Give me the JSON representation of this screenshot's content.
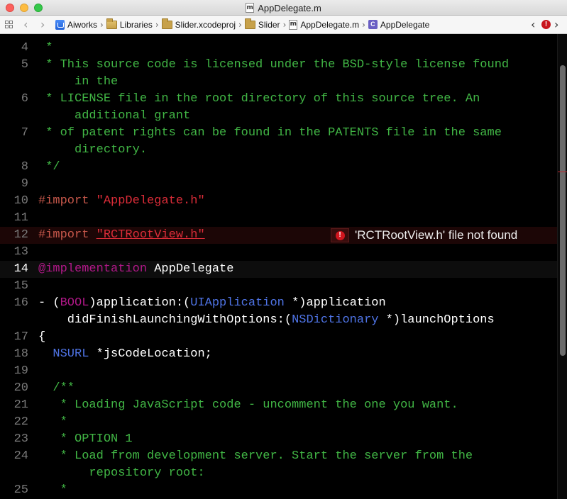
{
  "window": {
    "title": "AppDelegate.m",
    "file_icon_letter": "m"
  },
  "jumpbar": {
    "crumbs": [
      {
        "label": "Aiworks",
        "icon": "xcodeproj-icon"
      },
      {
        "label": "Libraries",
        "icon": "folder-icon"
      },
      {
        "label": "Slider.xcodeproj",
        "icon": "folder-icon"
      },
      {
        "label": "Slider",
        "icon": "folder-icon"
      },
      {
        "label": "AppDelegate.m",
        "icon": "m-file-icon",
        "letter": "m"
      },
      {
        "label": "AppDelegate",
        "icon": "class-icon",
        "letter": "C"
      }
    ],
    "issue_glyph": "!"
  },
  "editor": {
    "lines": [
      "4",
      "5",
      "6",
      "7",
      "8",
      "9",
      "10",
      "11",
      "12",
      "13",
      "14",
      "15",
      "16",
      "17",
      "18",
      "19",
      "20",
      "21",
      "22",
      "23",
      "24",
      "25"
    ],
    "current_line": "14",
    "error": {
      "glyph": "!",
      "message": "'RCTRootView.h' file not found"
    }
  },
  "colors": {
    "comment": "#41b645",
    "keyword": "#b21889",
    "preprocessor": "#c8584b",
    "string": "#db2c38",
    "type": "#4f74e6"
  }
}
